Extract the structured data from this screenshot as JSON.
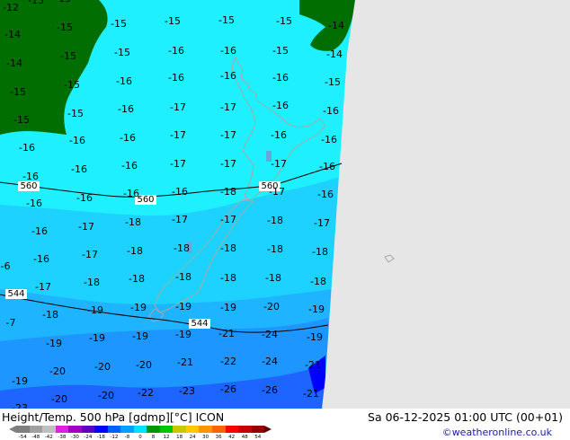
{
  "colors": {
    "land": "#006e00",
    "band_minus16": "#1ef0ff",
    "band_minus18": "#1ed2ff",
    "band_minus20": "#1eb4ff",
    "band_minus22": "#1e96ff",
    "band_minus26": "#1e64ff",
    "band_minus28": "#0000ff",
    "no_data": "#e6e6e6",
    "coastline": "#a8a8a8",
    "contour": "#000000",
    "credit_text": "#1a1aa6"
  },
  "map": {
    "contours": [
      {
        "label": "560"
      },
      {
        "label": "544"
      }
    ],
    "temperatures": [
      {
        "text": "-12"
      },
      {
        "text": "-13"
      },
      {
        "text": "-13"
      },
      {
        "text": "-14"
      },
      {
        "text": "-15"
      },
      {
        "text": "-15"
      },
      {
        "text": "-15"
      },
      {
        "text": "-15"
      },
      {
        "text": "-15"
      },
      {
        "text": "-14"
      },
      {
        "text": "-14"
      },
      {
        "text": "-15"
      },
      {
        "text": "-15"
      },
      {
        "text": "-16"
      },
      {
        "text": "-16"
      },
      {
        "text": "-15"
      },
      {
        "text": "-14"
      },
      {
        "text": "-15"
      },
      {
        "text": "-15"
      },
      {
        "text": "-16"
      },
      {
        "text": "-16"
      },
      {
        "text": "-16"
      },
      {
        "text": "-16"
      },
      {
        "text": "-15"
      },
      {
        "text": "-15"
      },
      {
        "text": "-15"
      },
      {
        "text": "-16"
      },
      {
        "text": "-17"
      },
      {
        "text": "-17"
      },
      {
        "text": "-16"
      },
      {
        "text": "-16"
      },
      {
        "text": "-16"
      },
      {
        "text": "-16"
      },
      {
        "text": "-16"
      },
      {
        "text": "-17"
      },
      {
        "text": "-17"
      },
      {
        "text": "-16"
      },
      {
        "text": "-16"
      },
      {
        "text": "-16"
      },
      {
        "text": "-16"
      },
      {
        "text": "-16"
      },
      {
        "text": "-17"
      },
      {
        "text": "-17"
      },
      {
        "text": "-17"
      },
      {
        "text": "-16"
      },
      {
        "text": "-16"
      },
      {
        "text": "-16"
      },
      {
        "text": "-16"
      },
      {
        "text": "-16"
      },
      {
        "text": "-18"
      },
      {
        "text": "-17"
      },
      {
        "text": "-16"
      },
      {
        "text": "-16"
      },
      {
        "text": "-17"
      },
      {
        "text": "-18"
      },
      {
        "text": "-17"
      },
      {
        "text": "-17"
      },
      {
        "text": "-18"
      },
      {
        "text": "-17"
      },
      {
        "text": "-16"
      },
      {
        "text": "-17"
      },
      {
        "text": "-18"
      },
      {
        "text": "-18"
      },
      {
        "text": "-18"
      },
      {
        "text": "-18"
      },
      {
        "text": "-18"
      },
      {
        "text": "-17"
      },
      {
        "text": "-18"
      },
      {
        "text": "-18"
      },
      {
        "text": "-18"
      },
      {
        "text": "-18"
      },
      {
        "text": "-18"
      },
      {
        "text": "-18"
      },
      {
        "text": "-18"
      },
      {
        "text": "-19"
      },
      {
        "text": "-19"
      },
      {
        "text": "-19"
      },
      {
        "text": "-19"
      },
      {
        "text": "-20"
      },
      {
        "text": "-19"
      },
      {
        "text": "-19"
      },
      {
        "text": "-19"
      },
      {
        "text": "-19"
      },
      {
        "text": "-19"
      },
      {
        "text": "-21"
      },
      {
        "text": "-24"
      },
      {
        "text": "-19"
      },
      {
        "text": "-20"
      },
      {
        "text": "-20"
      },
      {
        "text": "-20"
      },
      {
        "text": "-21"
      },
      {
        "text": "-22"
      },
      {
        "text": "-24"
      },
      {
        "text": "-21"
      },
      {
        "text": "-20"
      },
      {
        "text": "-20"
      },
      {
        "text": "-22"
      },
      {
        "text": "-23"
      },
      {
        "text": "-26"
      },
      {
        "text": "-26"
      },
      {
        "text": "-21"
      },
      {
        "text": "-23"
      },
      {
        "text": "-19"
      },
      {
        "text": "-7"
      },
      {
        "text": "-6"
      }
    ]
  },
  "footer": {
    "title": "Height/Temp. 500 hPa [gdmp][°C] ICON",
    "datetime": "Sa 06-12-2025 01:00 UTC (00+01)",
    "credit": "©weatheronline.co.uk",
    "colorbar": {
      "ticks": [
        "-54",
        "-48",
        "-42",
        "-38",
        "-30",
        "-24",
        "-18",
        "-12",
        "-8",
        "0",
        "8",
        "12",
        "18",
        "24",
        "30",
        "36",
        "42",
        "48",
        "54"
      ],
      "colors": [
        "#7f7f7f",
        "#a0a0a0",
        "#c0c0c0",
        "#e020e0",
        "#a000c0",
        "#6000c0",
        "#0000ff",
        "#0060ff",
        "#00a0ff",
        "#00e0ff",
        "#009600",
        "#00c800",
        "#c8c800",
        "#ffc800",
        "#ff9600",
        "#ff6400",
        "#ff0000",
        "#c80000",
        "#960000"
      ]
    }
  }
}
